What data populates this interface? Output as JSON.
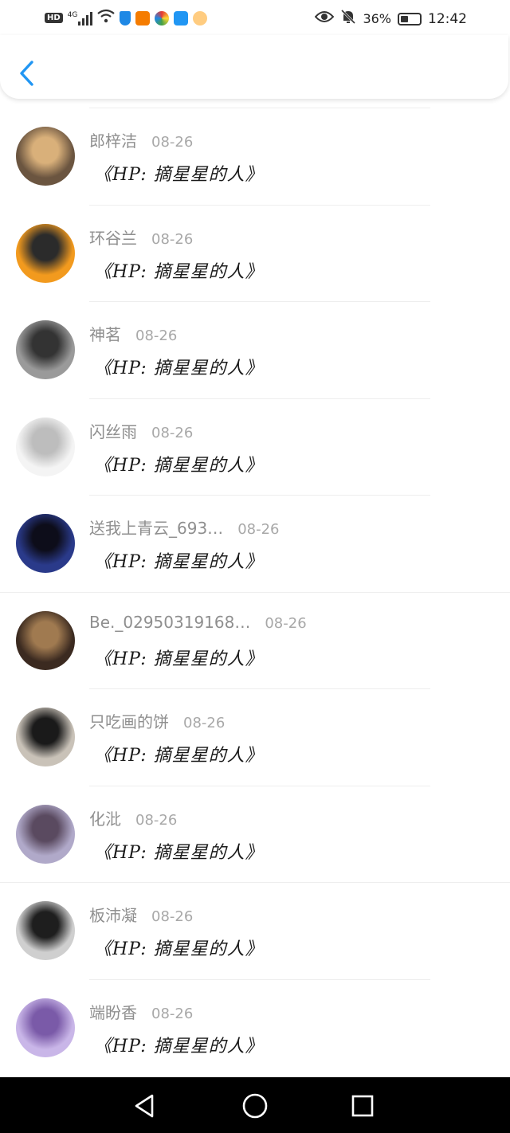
{
  "status_bar": {
    "network": "HD",
    "signal_type": "4G",
    "battery_percent": "36%",
    "time": "12:42"
  },
  "header": {
    "back_icon": "chevron-left-icon",
    "accent_color": "#2196f3"
  },
  "items": [
    {
      "name": "郎梓洁",
      "date": "08-26",
      "message": "《HP: 摘星星的人》",
      "avatar_colors": [
        "#6b5540",
        "#d9b07a"
      ]
    },
    {
      "name": "环谷兰",
      "date": "08-26",
      "message": "《HP: 摘星星的人》",
      "avatar_colors": [
        "#f29a1e",
        "#2b2b2b"
      ]
    },
    {
      "name": "神茗",
      "date": "08-26",
      "message": "《HP: 摘星星的人》",
      "avatar_colors": [
        "#9a9a9a",
        "#333333"
      ]
    },
    {
      "name": "闪丝雨",
      "date": "08-26",
      "message": "《HP: 摘星星的人》",
      "avatar_colors": [
        "#f4f4f4",
        "#bdbdbd"
      ]
    },
    {
      "name": "送我上青云_693…",
      "date": "08-26",
      "message": "《HP: 摘星星的人》",
      "avatar_colors": [
        "#2a3a8a",
        "#0d0d1a"
      ]
    },
    {
      "name": "Be._02950319168…",
      "date": "08-26",
      "message": "《HP: 摘星星的人》",
      "avatar_colors": [
        "#3b2a20",
        "#a07a50"
      ]
    },
    {
      "name": "只吃画的饼",
      "date": "08-26",
      "message": "《HP: 摘星星的人》",
      "avatar_colors": [
        "#c9c2b8",
        "#1a1a1a"
      ]
    },
    {
      "name": "化沘",
      "date": "08-26",
      "message": "《HP: 摘星星的人》",
      "avatar_colors": [
        "#b0a9c9",
        "#5a4a60"
      ]
    },
    {
      "name": "板沛凝",
      "date": "08-26",
      "message": "《HP: 摘星星的人》",
      "avatar_colors": [
        "#cfcfcf",
        "#1e1e1e"
      ]
    },
    {
      "name": "端盼香",
      "date": "08-26",
      "message": "《HP: 摘星星的人》",
      "avatar_colors": [
        "#c9b6e8",
        "#7a5aa8"
      ]
    }
  ],
  "nav": {
    "back": "triangle-back-icon",
    "home": "circle-home-icon",
    "recents": "square-recents-icon"
  }
}
